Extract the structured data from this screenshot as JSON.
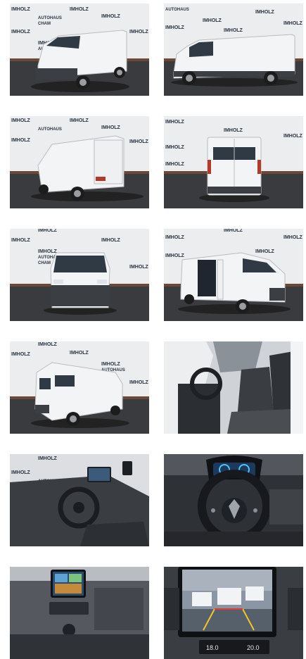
{
  "gallery": {
    "watermark": {
      "line1": "IMHOLZ",
      "line2": "AUTOHAUS",
      "line3": "CHAM"
    },
    "photos": [
      {
        "view": "front-left-3-4-exterior"
      },
      {
        "view": "left-side-exterior"
      },
      {
        "view": "rear-left-3-4-exterior"
      },
      {
        "view": "rear-exterior"
      },
      {
        "view": "front-exterior"
      },
      {
        "view": "right-side-open-sliding-door"
      },
      {
        "view": "rear-left-3-4-exterior-2"
      },
      {
        "view": "cab-seats-interior"
      },
      {
        "view": "dashboard-driver-view"
      },
      {
        "view": "steering-wheel-instrument-cluster"
      },
      {
        "view": "center-console-touchscreen"
      },
      {
        "view": "touchscreen-rear-camera"
      }
    ],
    "screen_text": {
      "temp_left": "18.0",
      "temp_right": "20.0"
    }
  }
}
